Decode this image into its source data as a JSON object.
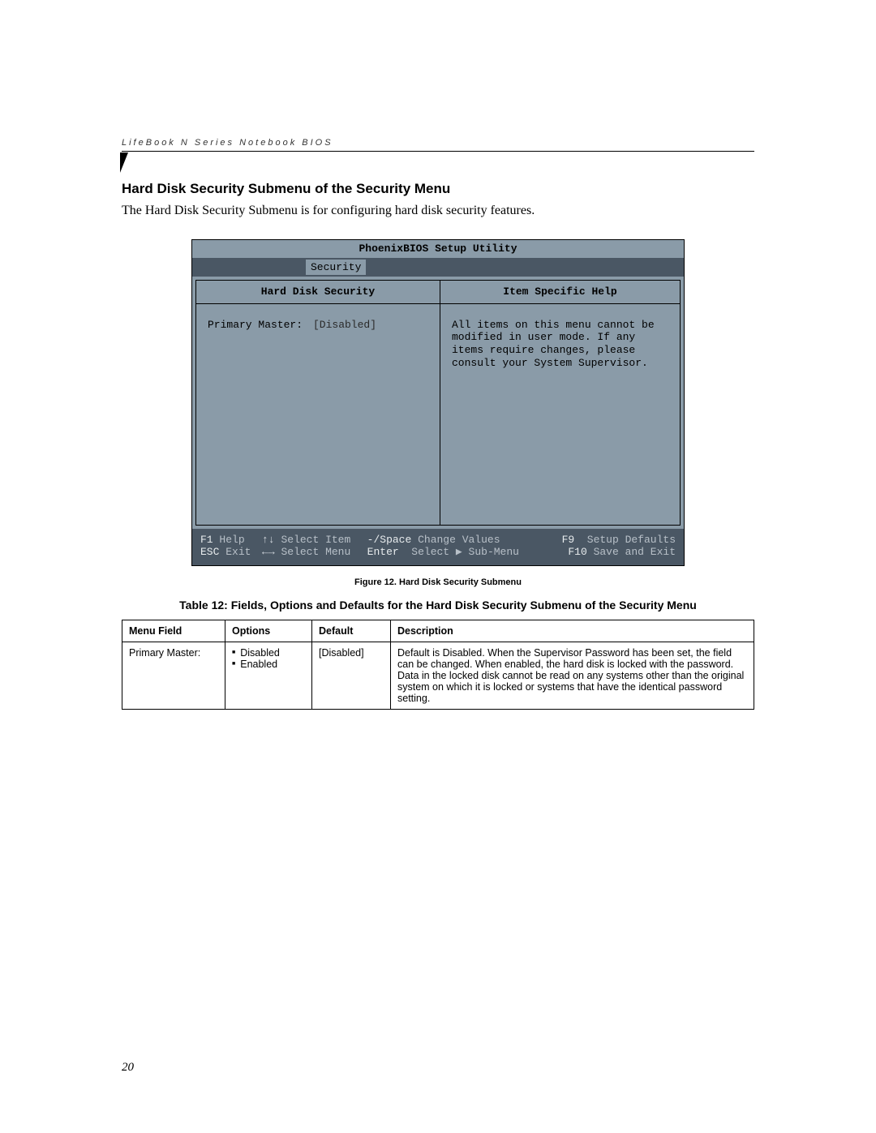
{
  "header": {
    "running": "LifeBook N Series Notebook BIOS"
  },
  "section": {
    "title": "Hard Disk Security Submenu of the Security Menu",
    "intro": "The Hard Disk Security Submenu is for configuring hard disk security features."
  },
  "bios": {
    "title": "PhoenixBIOS Setup Utility",
    "active_tab": "Security",
    "left_head": "Hard Disk Security",
    "right_head": "Item Specific Help",
    "field_label": "Primary Master:",
    "field_value": "[Disabled]",
    "help_text": "All items on this menu cannot be modified in user mode. If any items require changes, please consult your System Supervisor.",
    "footer": {
      "f1_key": "F1",
      "f1_label": "Help",
      "esc_key": "ESC",
      "esc_label": "Exit",
      "updown": "↑↓",
      "updown_label": "Select Item",
      "leftright": "←→",
      "leftright_label": "Select Menu",
      "minus": "-/Space",
      "minus_label": "Change Values",
      "enter": "Enter",
      "enter_label_pre": "Select ",
      "enter_label_post": " Sub-Menu",
      "f9_key": "F9",
      "f9_label": "Setup Defaults",
      "f10_key": "F10",
      "f10_label": "Save and Exit"
    }
  },
  "figure_caption": "Figure 12.  Hard Disk Security Submenu",
  "table_caption": "Table 12: Fields, Options and Defaults for the Hard Disk Security Submenu of the Security Menu",
  "table": {
    "headers": [
      "Menu Field",
      "Options",
      "Default",
      "Description"
    ],
    "row": {
      "menu_field": "Primary Master:",
      "option1": "Disabled",
      "option2": "Enabled",
      "default": "[Disabled]",
      "desc": "Default is Disabled. When the Supervisor Password has been set, the field can be changed. When enabled, the hard disk is locked with the password. Data in the locked disk cannot be read on any systems other than the original system on which it is locked or systems that have the identical password setting."
    }
  },
  "page_number": "20"
}
